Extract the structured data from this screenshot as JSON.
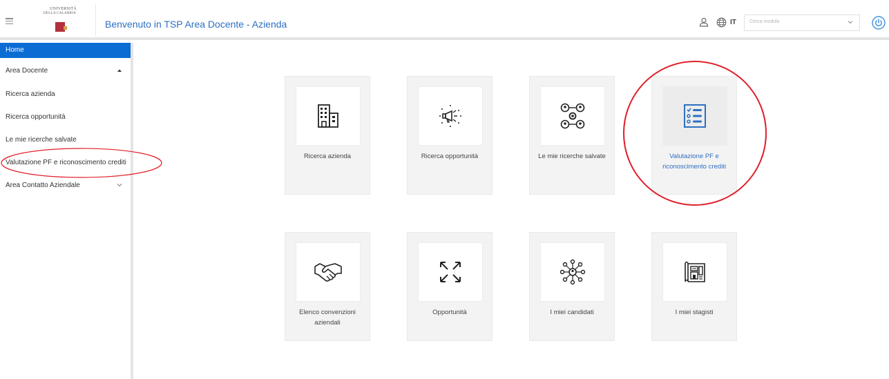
{
  "header": {
    "app_title": "Benvenuto in TSP Area Docente - Azienda",
    "logo_line1": "UNIVERSITÀ",
    "logo_line2": "DELLA CALABRIA",
    "language": "IT",
    "search_placeholder": "Cerca modulo"
  },
  "sidebar": {
    "items": [
      {
        "label": "Home",
        "active": true
      },
      {
        "label": "Area Docente",
        "expanded": true
      },
      {
        "label": "Ricerca azienda"
      },
      {
        "label": "Ricerca opportunità"
      },
      {
        "label": "Le mie ricerche salvate"
      },
      {
        "label": "Valutazione PF e riconoscimento crediti",
        "highlighted": true
      },
      {
        "label": "Area Contatto Aziendale",
        "expanded": false
      }
    ]
  },
  "tiles": [
    {
      "label": "Ricerca azienda",
      "icon": "office-building-icon"
    },
    {
      "label": "Ricerca opportunità",
      "icon": "megaphone-icon"
    },
    {
      "label": "Le mie ricerche salvate",
      "icon": "user-network-icon"
    },
    {
      "label": "Valutazione PF e riconoscimento crediti",
      "icon": "checklist-icon",
      "selected": true
    },
    {
      "label": "Elenco convenzioni aziendali",
      "icon": "handshake-icon"
    },
    {
      "label": "Opportunità",
      "icon": "expand-arrows-icon"
    },
    {
      "label": "I miei candidati",
      "icon": "candidate-network-icon"
    },
    {
      "label": "I miei stagisti",
      "icon": "blueprint-icon"
    }
  ],
  "colors": {
    "accent": "#2c6fc2",
    "active_menu": "#0b6cd4",
    "highlight_ring": "#e0202a"
  }
}
